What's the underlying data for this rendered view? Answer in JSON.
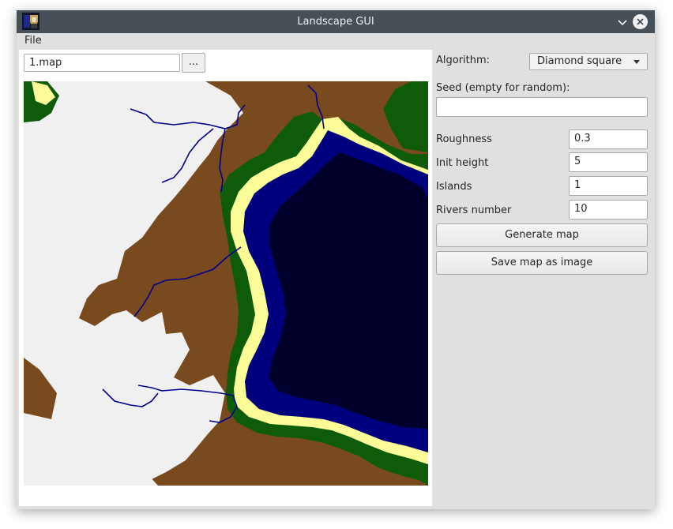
{
  "window": {
    "title": "Landscape GUI"
  },
  "menu": {
    "file": "File"
  },
  "file_picker": {
    "path": "1.map",
    "browse_label": "..."
  },
  "settings": {
    "algorithm_label": "Algorithm:",
    "algorithm_value": "Diamond square",
    "seed_label": "Seed (empty for random):",
    "seed_value": "",
    "roughness_label": "Roughness",
    "roughness_value": "0.3",
    "init_height_label": "Init height",
    "init_height_value": "5",
    "islands_label": "Islands",
    "islands_value": "1",
    "rivers_label": "Rivers number",
    "rivers_value": "10",
    "generate_button": "Generate map",
    "save_button": "Save map as image"
  },
  "map_colors": {
    "snow": "#f0f0f0",
    "mountain": "#7a4a1f",
    "forest": "#0e5c0a",
    "sand": "#fbfb98",
    "shallow_water": "#00007e",
    "deep_water": "#00002a",
    "river": "#00008b"
  }
}
